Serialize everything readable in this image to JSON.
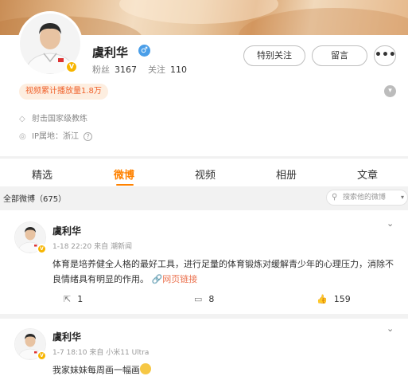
{
  "profile": {
    "name": "虞利华",
    "gender_symbol": "♂",
    "verified_symbol": "V",
    "fans_label": "粉丝",
    "fans_count": "3167",
    "following_label": "关注",
    "following_count": "110",
    "special_follow_label": "特别关注",
    "message_label": "留言",
    "more_symbol": "•••",
    "plays_badge": "视频累计播放量1.8万",
    "description": "射击国家级教练",
    "ip_location": "IP属地：浙江",
    "help_symbol": "?"
  },
  "tabs": [
    {
      "label": "精选"
    },
    {
      "label": "微博"
    },
    {
      "label": "视频"
    },
    {
      "label": "相册"
    },
    {
      "label": "文章"
    }
  ],
  "filter": {
    "title": "全部微博（675）",
    "search_placeholder": "搜索他的微博"
  },
  "posts": [
    {
      "author": "虞利华",
      "time": "1-18 22:20",
      "source_label": "来自",
      "source": "潮新闻",
      "text": "体育是培养健全人格的最好工具，进行足量的体育锻炼对缓解青少年的心理压力，消除不良情绪具有明显的作用。",
      "link_text": "网页链接",
      "reposts": "1",
      "comments": "8",
      "likes": "159"
    },
    {
      "author": "虞利华",
      "time": "1-7 18:10",
      "source_label": "来自",
      "source": "小米11 Ultra",
      "text": "我家妹妹每周画一幅画"
    }
  ],
  "colors": {
    "accent": "#ff8200",
    "link": "#eb7350",
    "badge_bg": "#fdeee0",
    "badge_text": "#f0622b",
    "verified": "#f7b500"
  },
  "icons": [
    "chevron-down-icon",
    "search-icon",
    "repost-icon",
    "comment-icon",
    "like-icon",
    "shield-icon",
    "location-icon"
  ]
}
